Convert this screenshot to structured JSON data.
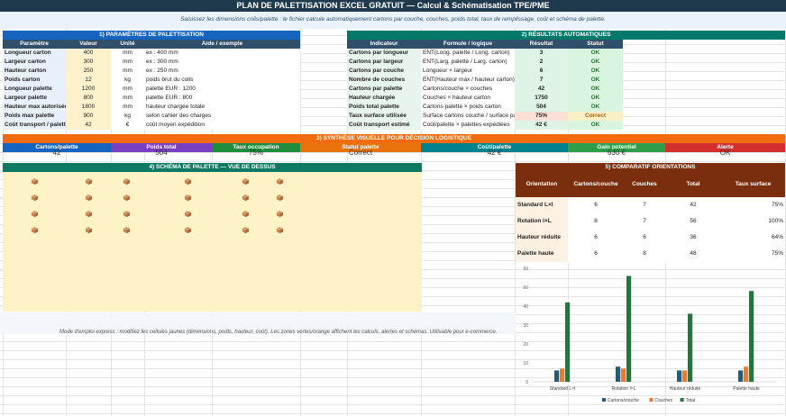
{
  "title": "PLAN DE PALETTISATION EXCEL GRATUIT — Calcul & Schématisation TPE/PME",
  "subtitle": "Saisissez les dimensions colis/palette : le fichier calcule automatiquement cartons par couche, couches, poids total, taux de remplissage, coût et schéma de palette.",
  "params": {
    "section_title": "1) PARAMÈTRES DE PALETTISATION",
    "headers": [
      "Paramètre",
      "Valeur",
      "Unité",
      "Aide / exemple"
    ],
    "rows": [
      [
        "Longueur carton",
        "400",
        "mm",
        "ex : 400 mm"
      ],
      [
        "Largeur carton",
        "300",
        "mm",
        "ex : 300 mm"
      ],
      [
        "Hauteur carton",
        "250",
        "mm",
        "ex : 250 mm"
      ],
      [
        "Poids carton",
        "12",
        "kg",
        "poids brut du colis"
      ],
      [
        "Longueur palette",
        "1200",
        "mm",
        "palette EUR : 1200"
      ],
      [
        "Largeur palette",
        "800",
        "mm",
        "palette EUR : 800"
      ],
      [
        "Hauteur max autorisée",
        "1800",
        "mm",
        "hauteur chargée totale"
      ],
      [
        "Poids max palette",
        "900",
        "kg",
        "selon cahier des charges"
      ],
      [
        "Coût transport / palette",
        "42",
        "€",
        "coût moyen expédition"
      ]
    ]
  },
  "results": {
    "section_title": "2) RÉSULTATS AUTOMATIQUES",
    "headers": [
      "Indicateur",
      "Formule / logique",
      "Résultat",
      "Statut"
    ],
    "rows": [
      [
        "Cartons par longueur",
        "ENT(Long. palette / Long. carton)",
        "3",
        "OK"
      ],
      [
        "Cartons par largeur",
        "ENT(Larg. palette / Larg. carton)",
        "2",
        "OK"
      ],
      [
        "Cartons par couche",
        "Longueur × largeur",
        "6",
        "OK"
      ],
      [
        "Nombre de couches",
        "ENT(Hauteur max / hauteur carton)",
        "7",
        "OK"
      ],
      [
        "Cartons par palette",
        "Cartons/couche × couches",
        "42",
        "OK"
      ],
      [
        "Hauteur chargée",
        "Couches × hauteur carton",
        "1750",
        "OK"
      ],
      [
        "Poids total palette",
        "Cartons palette × poids carton",
        "504",
        "OK"
      ],
      [
        "Taux surface utilisée",
        "Surface cartons couche / surface palette",
        "75%",
        "Correct"
      ],
      [
        "Coût transport estimé",
        "Coût/palette × palettes expédiées",
        "42 €",
        "OK"
      ]
    ]
  },
  "synthesis": {
    "section_title": "3) SYNTHÈSE VISUELLE POUR DÉCISION LOGISTIQUE",
    "tiles": [
      {
        "label": "Cartons/palette",
        "value": "42",
        "color": "#1565c0"
      },
      {
        "label": "Poids total",
        "value": "504",
        "color": "#7b3fc4"
      },
      {
        "label": "Taux occupation",
        "value": "75%",
        "color": "#1e8e3e"
      },
      {
        "label": "Statut palette",
        "value": "Correct",
        "color": "#e8730c"
      },
      {
        "label": "Coût/palette",
        "value": "42 €",
        "color": "#00838f"
      },
      {
        "label": "Gain potentiel",
        "value": "630 €",
        "color": "#2e9e4a"
      },
      {
        "label": "Alerte",
        "value": "OK",
        "color": "#d32f2f"
      }
    ]
  },
  "schema": {
    "section_title": "4) SCHÉMA DE PALETTE — VUE DE DESSUS"
  },
  "orientations": {
    "section_title": "5) COMPARATIF ORIENTATIONS",
    "headers": [
      "Orientation",
      "Cartons/couche",
      "Couches",
      "Total",
      "Taux surface"
    ],
    "rows": [
      [
        "Standard L×l",
        "6",
        "7",
        "42",
        "75%"
      ],
      [
        "Rotation l×L",
        "8",
        "7",
        "56",
        "100%"
      ],
      [
        "Hauteur réduite",
        "6",
        "6",
        "36",
        "64%"
      ],
      [
        "Palette haute",
        "6",
        "8",
        "48",
        "75%"
      ]
    ]
  },
  "instructions": "Mode d'emploi express : modifiez les cellules jaunes (dimensions, poids, hauteur, coût). Les zones vertes/orange affichent les calculs, alertes et schémas. Utilisable pour e-commerce.",
  "colors": {
    "title_bg": "#1f3a4d",
    "params_header": "#1565c0",
    "results_header": "#00796b",
    "synth_header": "#f26b0f",
    "schema_header": "#0f7a63",
    "orient_header": "#7a2e0e",
    "orient_row_bg": "#fdf1e4",
    "input_bg": "#fdf2cc",
    "ok_bg": "#d9f5df",
    "warn_bg": "#fde0d6"
  },
  "chart_data": {
    "type": "bar",
    "categories": [
      "Standard L×l",
      "Rotation l×L",
      "Hauteur réduite",
      "Palette haute"
    ],
    "series": [
      {
        "name": "Cartons/couche",
        "values": [
          6,
          8,
          6,
          6
        ],
        "color": "#1f5f7a"
      },
      {
        "name": "Couches",
        "values": [
          7,
          7,
          6,
          8
        ],
        "color": "#f07a2a"
      },
      {
        "name": "Total",
        "values": [
          42,
          56,
          36,
          48
        ],
        "color": "#1e7a3a"
      }
    ],
    "ylim": [
      0,
      60
    ],
    "yticks": [
      0,
      10,
      20,
      30,
      40,
      50,
      60
    ],
    "grid": false,
    "legend": "bottom"
  }
}
